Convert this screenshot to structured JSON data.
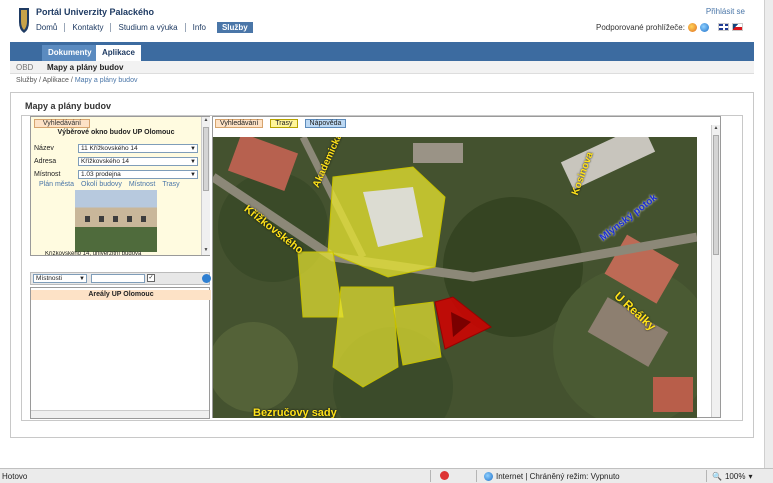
{
  "header": {
    "portal_title": "Portál Univerzity Palackého",
    "login": "Přihlásit se",
    "supported_browsers": "Podporované prohlížeče:",
    "nav": [
      "Domů",
      "Kontakty",
      "Studium a výuka",
      "Info",
      "Služby"
    ],
    "nav_active_index": 4,
    "flags": [
      "english-flag",
      "czech-flag"
    ]
  },
  "tabs": {
    "documents": "Dokumenty",
    "applications": "Aplikace",
    "active": "Aplikace"
  },
  "subbar": {
    "obd": "OBD",
    "title": "Mapy a plány budov"
  },
  "breadcrumb": {
    "items": [
      "Služby",
      "Aplikace",
      "Mapy a plány budov"
    ],
    "sep": "/"
  },
  "panel": {
    "title": "Mapy a plány budov"
  },
  "search_window": {
    "search_button": "Vyhledávání",
    "heading": "Výběrové okno budov UP Olomouc",
    "fields": [
      {
        "label": "Název",
        "value": "11 Křížkovského 14"
      },
      {
        "label": "Adresa",
        "value": "Křížkovského 14"
      },
      {
        "label": "Místnost",
        "value": "1.03 prodejna"
      }
    ],
    "links": [
      "Plán města",
      "Okolí budovy",
      "Místnost",
      "Trasy"
    ],
    "photo_caption": "Křížkovského 14, univerzitní budova"
  },
  "filter": {
    "select": "Místnosti",
    "input": "",
    "checked": true
  },
  "areas": {
    "heading": "Areály UP Olomouc"
  },
  "map_tabs": [
    "Vyhledávání",
    "Trasy",
    "Nápověda"
  ],
  "map_labels": [
    "Akademická",
    "Křížkovského",
    "Kosinova",
    "Mlýnský potok",
    "U Reálky",
    "Bezručovy sady"
  ],
  "status": {
    "left": "Hotovo",
    "zone": "Internet | Chráněný režim: Vypnuto",
    "zoom": "100%"
  },
  "colors": {
    "brand": "#3c6ba0",
    "highlight_yellow": "#e8e630",
    "highlight_red": "#d40000"
  }
}
